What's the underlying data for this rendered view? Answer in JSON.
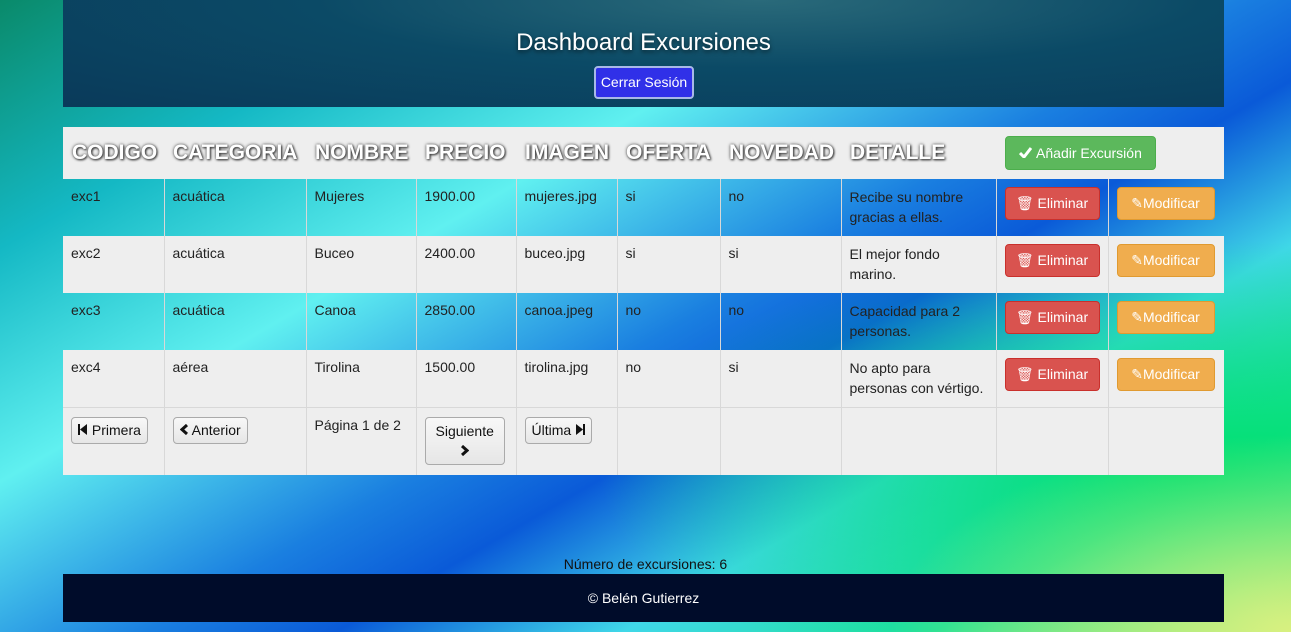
{
  "header": {
    "title": "Dashboard Excursiones",
    "logout_label": "Cerrar Sesión"
  },
  "table": {
    "columns": [
      "CODIGO",
      "CATEGORIA",
      "NOMBRE",
      "PRECIO",
      "IMAGEN",
      "OFERTA",
      "NOVEDAD",
      "DETALLE"
    ],
    "add_label": "Añadir Excursión",
    "delete_label": "Eliminar",
    "modify_label": "Modificar",
    "rows": [
      {
        "codigo": "exc1",
        "categoria": "acuática",
        "nombre": "Mujeres",
        "precio": "1900.00",
        "imagen": "mujeres.jpg",
        "oferta": "si",
        "novedad": "no",
        "detalle": "Recibe su nombre gracias a ellas."
      },
      {
        "codigo": "exc2",
        "categoria": "acuática",
        "nombre": "Buceo",
        "precio": "2400.00",
        "imagen": "buceo.jpg",
        "oferta": "si",
        "novedad": "si",
        "detalle": "El mejor fondo marino."
      },
      {
        "codigo": "exc3",
        "categoria": "acuática",
        "nombre": "Canoa",
        "precio": "2850.00",
        "imagen": "canoa.jpeg",
        "oferta": "no",
        "novedad": "no",
        "detalle": "Capacidad para 2 personas."
      },
      {
        "codigo": "exc4",
        "categoria": "aérea",
        "nombre": "Tirolina",
        "precio": "1500.00",
        "imagen": "tirolina.jpg",
        "oferta": "no",
        "novedad": "si",
        "detalle": "No apto para personas con vértigo."
      }
    ]
  },
  "pagination": {
    "first_label": "Primera",
    "prev_label": "Anterior",
    "page_info": "Página 1 de 2",
    "next_label": "Siguiente",
    "last_label": "Última"
  },
  "footer": {
    "count_text": "Número de excursiones: 6",
    "copyright": "© Belén Gutierrez"
  },
  "icons": {
    "check": "check-icon",
    "trash": "trash-icon",
    "pencil": "pencil-icon",
    "first": "step-backward-icon",
    "prev": "chevron-left-icon",
    "next": "chevron-right-icon",
    "last": "step-forward-icon"
  },
  "colors": {
    "delete": "#d9534f",
    "modify": "#f0ad4e",
    "add": "#5cb85c",
    "logout": "#3030e8",
    "footer": "#000c2a"
  }
}
